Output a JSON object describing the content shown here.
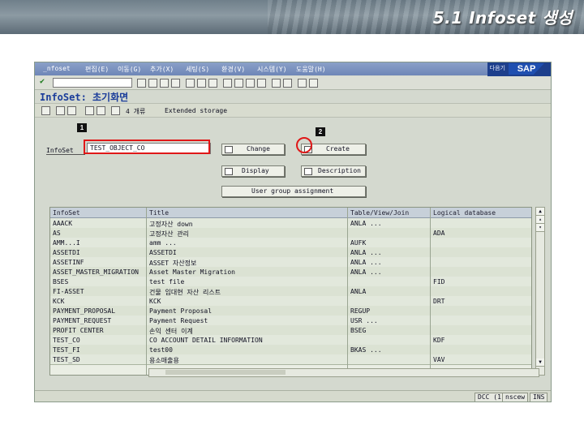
{
  "slide": {
    "title": "5.1 Infoset 생성"
  },
  "sap": {
    "menu": [
      "_nfoset",
      "편집(E)",
      "이동(G)",
      "추가(X)",
      "세팅(S)",
      "환경(V)",
      "시스템(Y)",
      "도움말(H)"
    ],
    "help_label": "다음기",
    "logo_text": "SAP",
    "screen_title": "InfoSet: 초기화면",
    "app_toolbar": {
      "item1": "4 개류",
      "item2": "Extended storage"
    },
    "markers": {
      "one": "1",
      "two": "2"
    },
    "infoset_label": "InfoSet",
    "infoset_value": "TEST_OBJECT_CO",
    "buttons": {
      "change": "Change",
      "create": "Create",
      "display": "Display",
      "description": "Description",
      "user_group": "User group assignment"
    },
    "table": {
      "headers": [
        "InfoSet",
        "Title",
        "Table/View/Join",
        "Logical database"
      ],
      "rows": [
        [
          "AAACK",
          "고정자산 down",
          "ANLA ...",
          ""
        ],
        [
          "AS",
          "고정자산 관리",
          "",
          "ADA"
        ],
        [
          "AMM...I",
          "amm ...",
          "AUFK",
          ""
        ],
        [
          "ASSETDI",
          "ASSETDI",
          "ANLA ...",
          ""
        ],
        [
          "ASSETINF",
          "ASSET 자산정보",
          "ANLA ...",
          ""
        ],
        [
          "ASSET_MASTER_MIGRATION",
          "Asset Master Migration",
          "ANLA ...",
          ""
        ],
        [
          "BSES",
          "test file",
          "",
          "FID"
        ],
        [
          "FI-ASSET",
          "건물 임대현 자산 리스트",
          "ANLA",
          ""
        ],
        [
          "KCK",
          "KCK",
          "",
          "DRT"
        ],
        [
          "PAYMENT_PROPOSAL",
          "Payment Proposal",
          "REGUP",
          ""
        ],
        [
          "PAYMENT_REQUEST",
          "Payment Request",
          "USR ...",
          ""
        ],
        [
          "PROFIT CENTER",
          "손익 센터 이계",
          "BSEG",
          ""
        ],
        [
          "TEST_CO",
          "CO ACCOUNT DETAIL INFORMATION",
          "",
          "KDF"
        ],
        [
          "TEST_FI",
          "test00",
          "BKAS ...",
          ""
        ],
        [
          "TEST_SD",
          "용소매출용",
          "",
          "VAV"
        ]
      ]
    },
    "status": {
      "client": "DCC (1)",
      "server": "nscew",
      "mode": "INS"
    }
  }
}
